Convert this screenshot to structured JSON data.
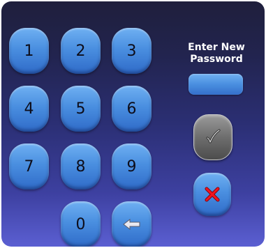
{
  "keypad": {
    "keys": [
      "1",
      "2",
      "3",
      "4",
      "5",
      "6",
      "7",
      "8",
      "9",
      "0"
    ]
  },
  "prompt": {
    "line1": "Enter New",
    "line2": "Password"
  },
  "password_field": {
    "value": ""
  },
  "icons": {
    "backspace": "backspace-arrow-icon",
    "confirm": "checkmark-icon",
    "cancel": "x-mark-icon"
  },
  "colors": {
    "key_blue": "#4a8fe0",
    "confirm_gray": "#6e6e6e",
    "cancel_red": "#e0101a",
    "panel_top": "#1f1f3c",
    "panel_bottom": "#5b5fd2"
  }
}
